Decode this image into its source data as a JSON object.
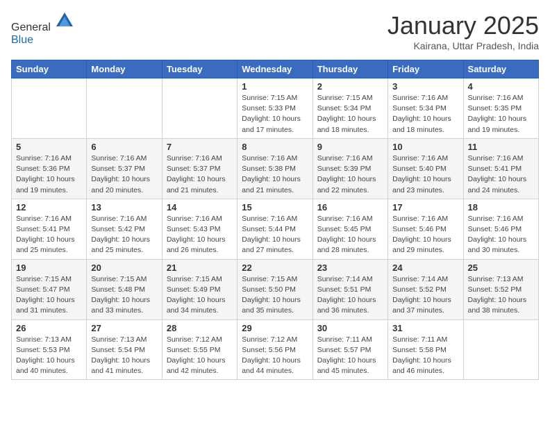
{
  "header": {
    "logo_line1": "General",
    "logo_line2": "Blue",
    "month_title": "January 2025",
    "location": "Kairana, Uttar Pradesh, India"
  },
  "weekdays": [
    "Sunday",
    "Monday",
    "Tuesday",
    "Wednesday",
    "Thursday",
    "Friday",
    "Saturday"
  ],
  "weeks": [
    [
      {
        "day": "",
        "info": ""
      },
      {
        "day": "",
        "info": ""
      },
      {
        "day": "",
        "info": ""
      },
      {
        "day": "1",
        "info": "Sunrise: 7:15 AM\nSunset: 5:33 PM\nDaylight: 10 hours\nand 17 minutes."
      },
      {
        "day": "2",
        "info": "Sunrise: 7:15 AM\nSunset: 5:34 PM\nDaylight: 10 hours\nand 18 minutes."
      },
      {
        "day": "3",
        "info": "Sunrise: 7:16 AM\nSunset: 5:34 PM\nDaylight: 10 hours\nand 18 minutes."
      },
      {
        "day": "4",
        "info": "Sunrise: 7:16 AM\nSunset: 5:35 PM\nDaylight: 10 hours\nand 19 minutes."
      }
    ],
    [
      {
        "day": "5",
        "info": "Sunrise: 7:16 AM\nSunset: 5:36 PM\nDaylight: 10 hours\nand 19 minutes."
      },
      {
        "day": "6",
        "info": "Sunrise: 7:16 AM\nSunset: 5:37 PM\nDaylight: 10 hours\nand 20 minutes."
      },
      {
        "day": "7",
        "info": "Sunrise: 7:16 AM\nSunset: 5:37 PM\nDaylight: 10 hours\nand 21 minutes."
      },
      {
        "day": "8",
        "info": "Sunrise: 7:16 AM\nSunset: 5:38 PM\nDaylight: 10 hours\nand 21 minutes."
      },
      {
        "day": "9",
        "info": "Sunrise: 7:16 AM\nSunset: 5:39 PM\nDaylight: 10 hours\nand 22 minutes."
      },
      {
        "day": "10",
        "info": "Sunrise: 7:16 AM\nSunset: 5:40 PM\nDaylight: 10 hours\nand 23 minutes."
      },
      {
        "day": "11",
        "info": "Sunrise: 7:16 AM\nSunset: 5:41 PM\nDaylight: 10 hours\nand 24 minutes."
      }
    ],
    [
      {
        "day": "12",
        "info": "Sunrise: 7:16 AM\nSunset: 5:41 PM\nDaylight: 10 hours\nand 25 minutes."
      },
      {
        "day": "13",
        "info": "Sunrise: 7:16 AM\nSunset: 5:42 PM\nDaylight: 10 hours\nand 25 minutes."
      },
      {
        "day": "14",
        "info": "Sunrise: 7:16 AM\nSunset: 5:43 PM\nDaylight: 10 hours\nand 26 minutes."
      },
      {
        "day": "15",
        "info": "Sunrise: 7:16 AM\nSunset: 5:44 PM\nDaylight: 10 hours\nand 27 minutes."
      },
      {
        "day": "16",
        "info": "Sunrise: 7:16 AM\nSunset: 5:45 PM\nDaylight: 10 hours\nand 28 minutes."
      },
      {
        "day": "17",
        "info": "Sunrise: 7:16 AM\nSunset: 5:46 PM\nDaylight: 10 hours\nand 29 minutes."
      },
      {
        "day": "18",
        "info": "Sunrise: 7:16 AM\nSunset: 5:46 PM\nDaylight: 10 hours\nand 30 minutes."
      }
    ],
    [
      {
        "day": "19",
        "info": "Sunrise: 7:15 AM\nSunset: 5:47 PM\nDaylight: 10 hours\nand 31 minutes."
      },
      {
        "day": "20",
        "info": "Sunrise: 7:15 AM\nSunset: 5:48 PM\nDaylight: 10 hours\nand 33 minutes."
      },
      {
        "day": "21",
        "info": "Sunrise: 7:15 AM\nSunset: 5:49 PM\nDaylight: 10 hours\nand 34 minutes."
      },
      {
        "day": "22",
        "info": "Sunrise: 7:15 AM\nSunset: 5:50 PM\nDaylight: 10 hours\nand 35 minutes."
      },
      {
        "day": "23",
        "info": "Sunrise: 7:14 AM\nSunset: 5:51 PM\nDaylight: 10 hours\nand 36 minutes."
      },
      {
        "day": "24",
        "info": "Sunrise: 7:14 AM\nSunset: 5:52 PM\nDaylight: 10 hours\nand 37 minutes."
      },
      {
        "day": "25",
        "info": "Sunrise: 7:13 AM\nSunset: 5:52 PM\nDaylight: 10 hours\nand 38 minutes."
      }
    ],
    [
      {
        "day": "26",
        "info": "Sunrise: 7:13 AM\nSunset: 5:53 PM\nDaylight: 10 hours\nand 40 minutes."
      },
      {
        "day": "27",
        "info": "Sunrise: 7:13 AM\nSunset: 5:54 PM\nDaylight: 10 hours\nand 41 minutes."
      },
      {
        "day": "28",
        "info": "Sunrise: 7:12 AM\nSunset: 5:55 PM\nDaylight: 10 hours\nand 42 minutes."
      },
      {
        "day": "29",
        "info": "Sunrise: 7:12 AM\nSunset: 5:56 PM\nDaylight: 10 hours\nand 44 minutes."
      },
      {
        "day": "30",
        "info": "Sunrise: 7:11 AM\nSunset: 5:57 PM\nDaylight: 10 hours\nand 45 minutes."
      },
      {
        "day": "31",
        "info": "Sunrise: 7:11 AM\nSunset: 5:58 PM\nDaylight: 10 hours\nand 46 minutes."
      },
      {
        "day": "",
        "info": ""
      }
    ]
  ]
}
